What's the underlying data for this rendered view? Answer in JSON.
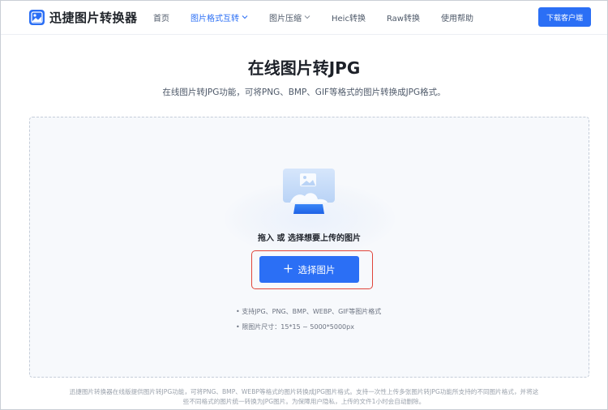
{
  "header": {
    "logo_text": "迅捷图片转换器",
    "nav": [
      {
        "label": "首页",
        "active": false,
        "dropdown": false
      },
      {
        "label": "图片格式互转",
        "active": true,
        "dropdown": true
      },
      {
        "label": "图片压缩",
        "active": false,
        "dropdown": true
      },
      {
        "label": "Heic转换",
        "active": false,
        "dropdown": false
      },
      {
        "label": "Raw转换",
        "active": false,
        "dropdown": false
      },
      {
        "label": "使用帮助",
        "active": false,
        "dropdown": false
      }
    ],
    "download_label": "下载客户端"
  },
  "main": {
    "title": "在线图片转JPG",
    "subtitle": "在线图片转JPG功能，可将PNG、BMP、GIF等格式的图片转换成JPG格式。"
  },
  "upload": {
    "hint": "拖入 或 选择想要上传的图片",
    "button_label": "选择图片",
    "spec_formats": "• 支持JPG、PNG、BMP、WEBP、GIF等图片格式",
    "spec_size": "• 限图片尺寸：15*15 ~ 5000*5000px"
  },
  "footer": {
    "line1": "迅捷图片转换器在线版提供图片转JPG功能，可将PNG、BMP、WEBP等格式的图片转换成JPG图片格式。支持一次性上传多张图片转JPG功能所支持的不同图片格式，并将这",
    "line2": "些不同格式的图片统一转换为JPG图片。为保障用户隐私，上传的文件1小时会自动删除。"
  },
  "colors": {
    "brand": "#2b6ff5",
    "highlight_border": "#e0443a"
  },
  "icons": {
    "logo": "image-logo-icon",
    "chevron": "chevron-down-icon",
    "plus": "plus-icon",
    "upload_illustration": "upload-monitor-icon"
  }
}
